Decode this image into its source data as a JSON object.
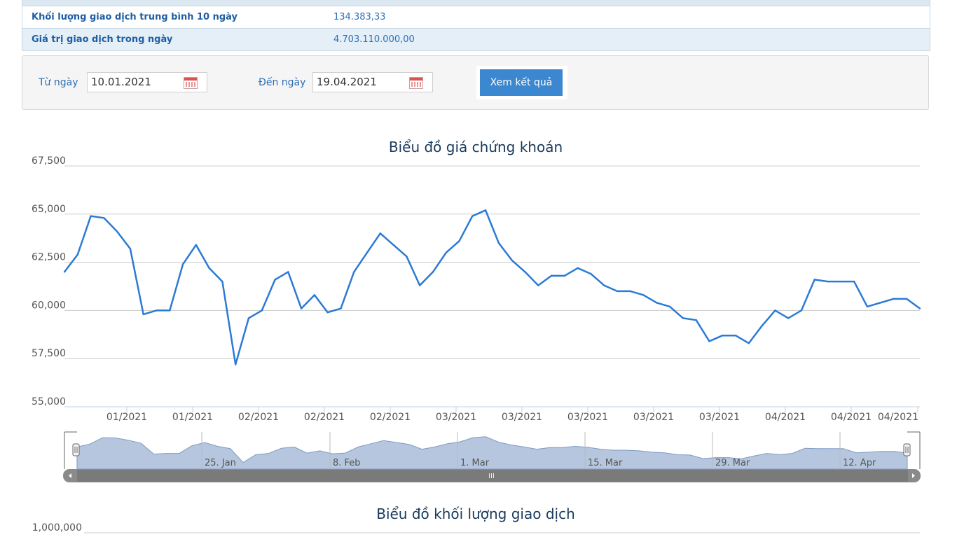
{
  "info_rows": [
    {
      "label": "Khối lượng giao dịch trung bình 10 ngày",
      "value": "134.383,33"
    },
    {
      "label": "Giá trị giao dịch trong ngày",
      "value": "4.703.110.000,00"
    }
  ],
  "filter": {
    "from_label": "Từ ngày",
    "from_value": "10.01.2021",
    "to_label": "Đến ngày",
    "to_value": "19.04.2021",
    "submit_label": "Xem kết quả"
  },
  "price_chart": {
    "title": "Biểu đồ giá chứng khoán",
    "y_tick_labels": [
      "67,500",
      "65,000",
      "62,500",
      "60,000",
      "57,500",
      "55,000"
    ],
    "x_tick_labels": [
      "01/2021",
      "01/2021",
      "02/2021",
      "02/2021",
      "02/2021",
      "03/2021",
      "03/2021",
      "03/2021",
      "03/2021",
      "03/2021",
      "04/2021",
      "04/2021",
      "04/2021"
    ],
    "navigator_labels": [
      "25. Jan",
      "8. Feb",
      "1. Mar",
      "15. Mar",
      "29. Mar",
      "12. Apr"
    ]
  },
  "volume_chart": {
    "title": "Biểu đồ khối lượng giao dịch",
    "y_tick_labels": [
      "1,000,000"
    ]
  },
  "colors": {
    "line": "#2b7bd4",
    "navigator_fill": "#b5c6de",
    "button": "#3b87d0"
  },
  "chart_data": {
    "type": "line",
    "title": "Biểu đồ giá chứng khoán",
    "xlabel": "",
    "ylabel": "",
    "ylim": [
      55000,
      67500
    ],
    "y_ticks": [
      55000,
      57500,
      60000,
      62500,
      65000,
      67500
    ],
    "x_tick_labels": [
      "01/2021",
      "01/2021",
      "02/2021",
      "02/2021",
      "02/2021",
      "03/2021",
      "03/2021",
      "03/2021",
      "03/2021",
      "03/2021",
      "04/2021",
      "04/2021",
      "04/2021"
    ],
    "grid": true,
    "series": [
      {
        "values": [
          62000,
          62900,
          64900,
          64800,
          64100,
          63200,
          59800,
          60000,
          60000,
          62400,
          63400,
          62200,
          61500,
          57200,
          59600,
          60000,
          61600,
          62000,
          60100,
          60800,
          59900,
          60100,
          62000,
          63000,
          64000,
          63400,
          62800,
          61300,
          62000,
          63000,
          63600,
          64900,
          65200,
          63500,
          62600,
          62000,
          61300,
          61800,
          61800,
          62200,
          61900,
          61300,
          61000,
          61000,
          60800,
          60400,
          60200,
          59600,
          59500,
          58400,
          58700,
          58700,
          58300,
          59200,
          60000,
          59600,
          60000,
          61600,
          61500,
          61500,
          61500,
          60200,
          60400,
          60600,
          60600,
          60100
        ]
      }
    ]
  }
}
